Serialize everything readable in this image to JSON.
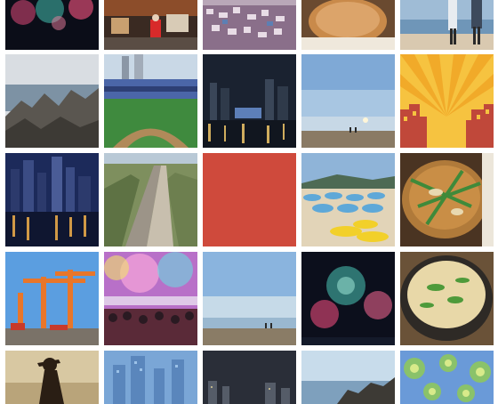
{
  "gallery": {
    "columns": 5,
    "rows": 5,
    "tiles": [
      {
        "id": 0,
        "icon": "fireworks-photo-icon"
      },
      {
        "id": 1,
        "icon": "street-festival-photo-icon"
      },
      {
        "id": 2,
        "icon": "hillside-village-photo-icon"
      },
      {
        "id": 3,
        "icon": "pancake-food-photo-icon"
      },
      {
        "id": 4,
        "icon": "beach-couple-photo-icon"
      },
      {
        "id": 5,
        "icon": "rocky-coast-photo-icon"
      },
      {
        "id": 6,
        "icon": "baseball-stadium-photo-icon"
      },
      {
        "id": 7,
        "icon": "night-harbor-photo-icon"
      },
      {
        "id": 8,
        "icon": "sunset-beach-photo-icon"
      },
      {
        "id": 9,
        "icon": "sunburst-illustration-icon"
      },
      {
        "id": 10,
        "icon": "city-night-skyline-photo-icon"
      },
      {
        "id": 11,
        "icon": "railway-path-photo-icon"
      },
      {
        "id": 12,
        "icon": "red-placeholder-icon",
        "color": "#cf4a3c"
      },
      {
        "id": 13,
        "icon": "beach-umbrellas-photo-icon"
      },
      {
        "id": 14,
        "icon": "seafood-pancake-photo-icon"
      },
      {
        "id": 15,
        "icon": "port-cranes-photo-icon"
      },
      {
        "id": 16,
        "icon": "festival-lights-photo-icon"
      },
      {
        "id": 17,
        "icon": "clear-sky-beach-photo-icon"
      },
      {
        "id": 18,
        "icon": "fireworks-night-photo-icon"
      },
      {
        "id": 19,
        "icon": "pork-soup-photo-icon"
      },
      {
        "id": 20,
        "icon": "silhouette-person-photo-icon"
      },
      {
        "id": 21,
        "icon": "blue-skyline-illustration-icon"
      },
      {
        "id": 22,
        "icon": "dusk-skyline-photo-icon"
      },
      {
        "id": 23,
        "icon": "coastal-rocks-photo-icon"
      },
      {
        "id": 24,
        "icon": "floral-pattern-icon"
      }
    ]
  },
  "colors": {
    "background": "#ffffff",
    "accent_red": "#cf4a3c",
    "sky_blue": "#7fb2e0",
    "night": "#121826"
  }
}
